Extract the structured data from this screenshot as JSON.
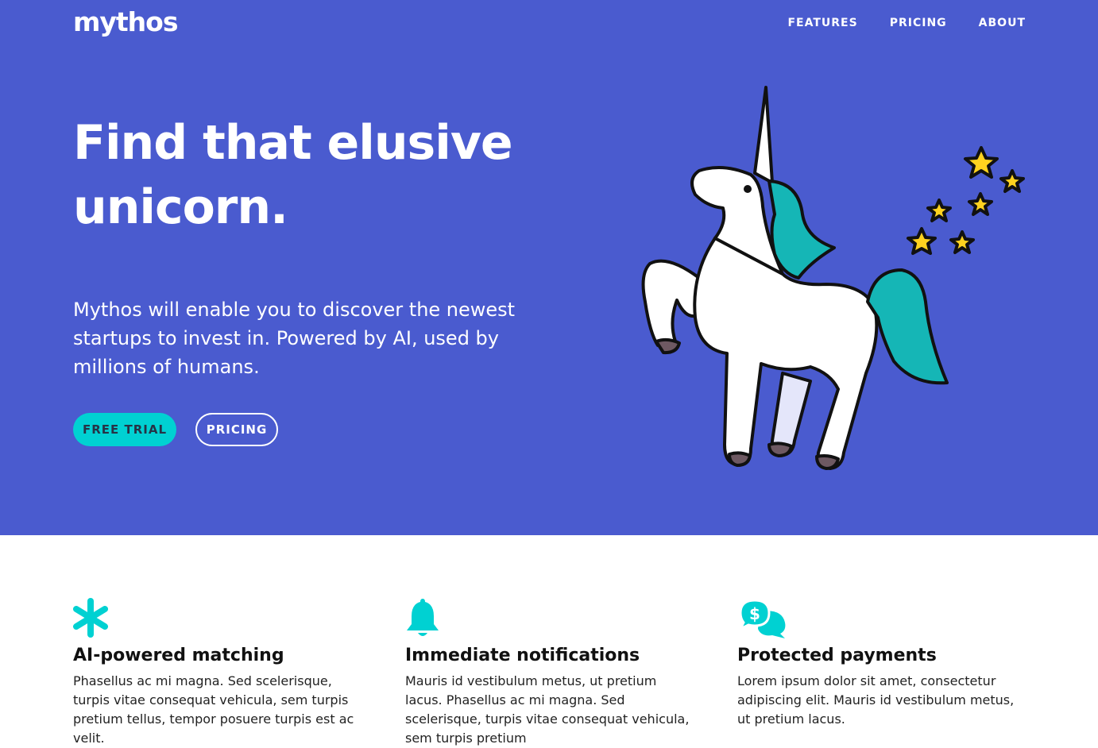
{
  "brand": {
    "logo": "mythos",
    "primary_color": "#4a5bcf",
    "accent_color": "#00d1d2"
  },
  "nav": {
    "items": [
      "FEATURES",
      "PRICING",
      "ABOUT"
    ]
  },
  "hero": {
    "headline_line1": "Find that elusive",
    "headline_line2": "unicorn.",
    "lead": "Mythos will enable you to discover the newest startups to invest in. Powered by AI, used by millions of humans.",
    "primary_button": "FREE TRIAL",
    "secondary_button": "PRICING",
    "illustration": "unicorn-illustration"
  },
  "features": [
    {
      "icon": "asterisk-icon",
      "title": "AI-powered matching",
      "text": "Phasellus ac mi magna. Sed scelerisque, turpis vitae consequat vehicula, sem turpis pretium tellus, tempor posuere turpis est ac velit."
    },
    {
      "icon": "bell-icon",
      "title": "Immediate notifications",
      "text": "Mauris id vestibulum metus, ut pretium lacus. Phasellus ac mi magna. Sed scelerisque, turpis vitae consequat vehicula, sem turpis pretium"
    },
    {
      "icon": "chat-dollar-icon",
      "title": "Protected payments",
      "text": "Lorem ipsum dolor sit amet, consectetur adipiscing elit. Mauris id vestibulum metus, ut pretium lacus."
    }
  ]
}
